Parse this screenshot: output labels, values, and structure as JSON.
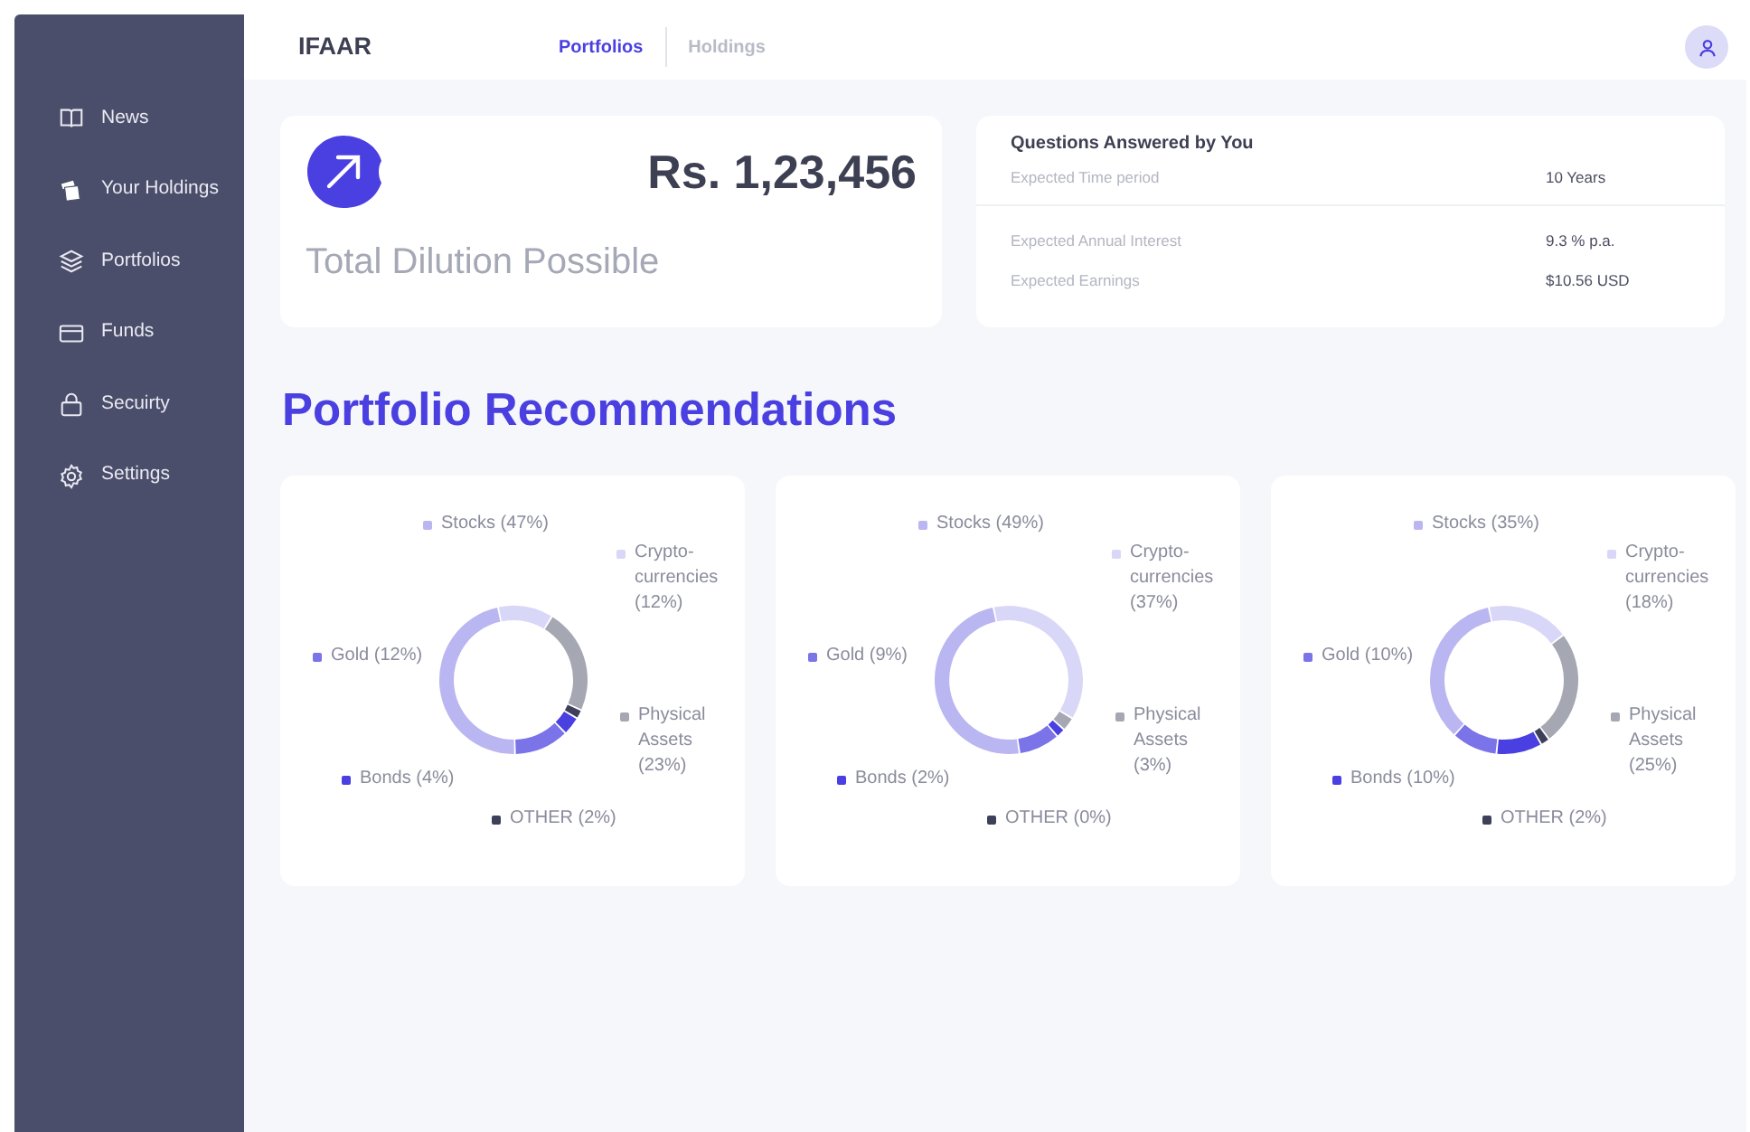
{
  "sidebar": {
    "items": [
      {
        "label": "News"
      },
      {
        "label": "Your Holdings"
      },
      {
        "label": "Portfolios"
      },
      {
        "label": "Funds"
      },
      {
        "label": "Secuirty"
      },
      {
        "label": "Settings"
      }
    ]
  },
  "header": {
    "brand": "IFAAR",
    "tabs": [
      {
        "label": "Portfolios",
        "selected": true
      },
      {
        "label": "Holdings",
        "selected": false
      }
    ]
  },
  "summary": {
    "amount": "Rs. 1,23,456",
    "caption": "Total Dilution Possible"
  },
  "questions": {
    "title": "Questions Answered by You",
    "rows": [
      {
        "label": "Expected Time period",
        "value": "10 Years"
      },
      {
        "label": "Expected Annual Interest",
        "value": "9.3 % p.a."
      },
      {
        "label": "Expected Earnings",
        "value": "$10.56 USD"
      }
    ]
  },
  "section_title": "Portfolio Recommendations",
  "portfolios": [
    {
      "chart_data": {
        "type": "donut",
        "categories": [
          "Crypto-currencies (12%)",
          "Physical Assets (23%)",
          "OTHER (2%)",
          "Bonds (4%)",
          "Gold (12%)",
          "Stocks (47%)"
        ],
        "legend": "top right",
        "values": [
          12,
          23,
          2,
          4,
          12,
          47
        ],
        "colors": [
          "#d9d7f7",
          "#a5a8b3",
          "#3e405a",
          "#4a3fe0",
          "#7b73e8",
          "#bab6f1"
        ]
      }
    },
    {
      "chart_data": {
        "type": "donut",
        "categories": [
          "Crypto-currencies (37%)",
          "Physical Assets (3%)",
          "OTHER (0%)",
          "Bonds (2%)",
          "Gold (9%)",
          "Stocks (49%)"
        ],
        "legend": "top right",
        "values": [
          37,
          3,
          0,
          2,
          9,
          49
        ],
        "colors": [
          "#d9d7f7",
          "#a5a8b3",
          "#3e405a",
          "#4a3fe0",
          "#7b73e8",
          "#bab6f1"
        ]
      }
    },
    {
      "chart_data": {
        "type": "donut",
        "categories": [
          "Crypto-currencies (18%)",
          "Physical Assets (25%)",
          "OTHER (2%)",
          "Bonds (10%)",
          "Gold (10%)",
          "Stocks (35%)"
        ],
        "legend": "top right",
        "values": [
          18,
          25,
          2,
          10,
          10,
          35
        ],
        "colors": [
          "#d9d7f7",
          "#a5a8b3",
          "#3e405a",
          "#4a3fe0",
          "#7b73e8",
          "#bab6f1"
        ]
      }
    }
  ]
}
